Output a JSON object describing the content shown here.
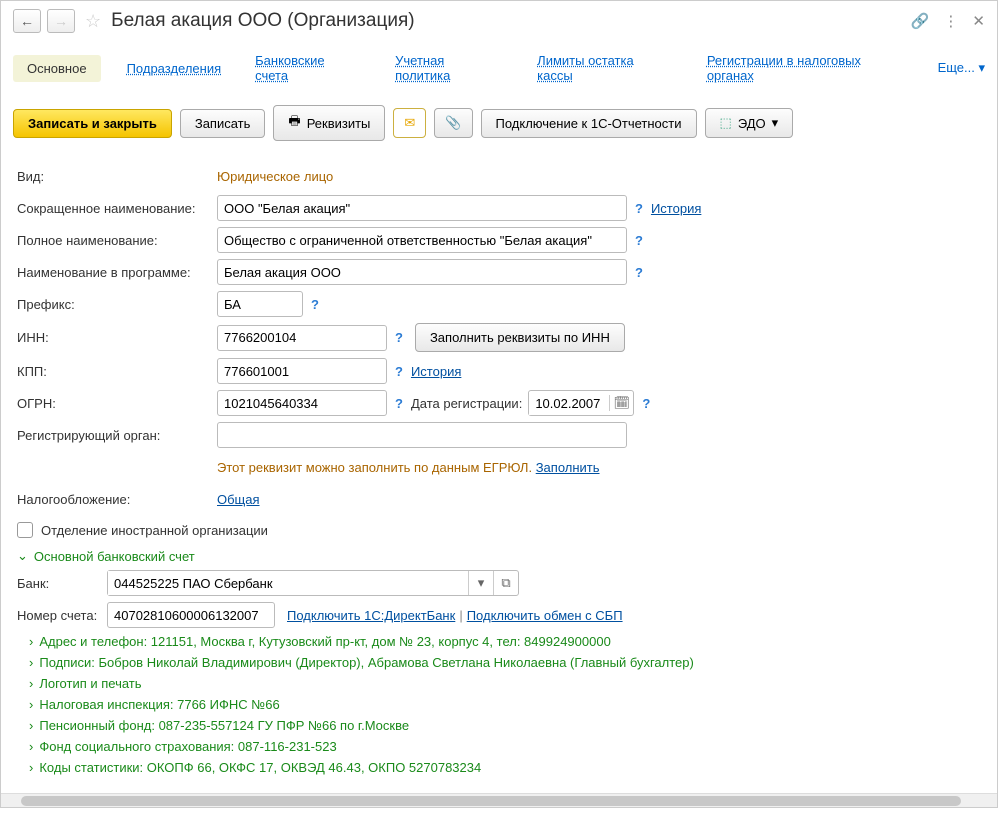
{
  "title": "Белая акация ООО (Организация)",
  "tabs": {
    "main": "Основное",
    "divisions": "Подразделения",
    "bank_accounts": "Банковские счета",
    "accounting_policy": "Учетная политика",
    "cash_limits": "Лимиты остатка кассы",
    "tax_registrations": "Регистрации в налоговых органах",
    "more": "Еще...   ▾"
  },
  "toolbar": {
    "save_close": "Записать и закрыть",
    "save": "Записать",
    "requisites": "Реквизиты",
    "connect_1c": "Подключение к 1С-Отчетности",
    "edo": "ЭДО"
  },
  "labels": {
    "type": "Вид:",
    "short_name": "Сокращенное наименование:",
    "full_name": "Полное наименование:",
    "program_name": "Наименование в программе:",
    "prefix": "Префикс:",
    "inn": "ИНН:",
    "kpp": "КПП:",
    "ogrn": "ОГРН:",
    "reg_date": "Дата регистрации:",
    "reg_authority": "Регистрирующий орган:",
    "taxation": "Налогообложение:",
    "foreign_branch": "Отделение иностранной организации",
    "bank": "Банк:",
    "account_number": "Номер счета:"
  },
  "values": {
    "type": "Юридическое лицо",
    "short_name": "ООО \"Белая акация\"",
    "full_name": "Общество с ограниченной ответственностью \"Белая акация\"",
    "program_name": "Белая акация ООО",
    "prefix": "БА",
    "inn": "7766200104",
    "kpp": "776601001",
    "ogrn": "1021045640334",
    "reg_date": "10.02.2007",
    "reg_authority": "",
    "taxation": "Общая",
    "bank": "044525225 ПАО Сбербанк",
    "account_number": "40702810600006132007"
  },
  "links": {
    "history": "История",
    "fill_by_inn": "Заполнить реквизиты по ИНН",
    "fill": "Заполнить",
    "egrul_note": "Этот реквизит можно заполнить по данным ЕГРЮЛ.",
    "connect_directbank": "Подключить 1С:ДиректБанк",
    "connect_sbp": "Подключить обмен с СБП"
  },
  "sections": {
    "bank_account": "Основной банковский счет",
    "address": "Адрес и телефон: 121151, Москва г, Кутузовский пр-кт, дом № 23, корпус 4, тел: 849924900000",
    "signatures": "Подписи: Бобров Николай Владимирович (Директор), Абрамова Светлана Николаевна (Главный бухгалтер)",
    "logo": "Логотип и печать",
    "tax_inspection": "Налоговая инспекция: 7766 ИФНС №66",
    "pension_fund": "Пенсионный фонд: 087-235-557124 ГУ ПФР №66 по г.Москве",
    "social_insurance": "Фонд социального страхования: 087-116-231-523",
    "statistics_codes": "Коды статистики: ОКОПФ 66, ОКФС 17, ОКВЭД 46.43, ОКПО 5270783234"
  }
}
